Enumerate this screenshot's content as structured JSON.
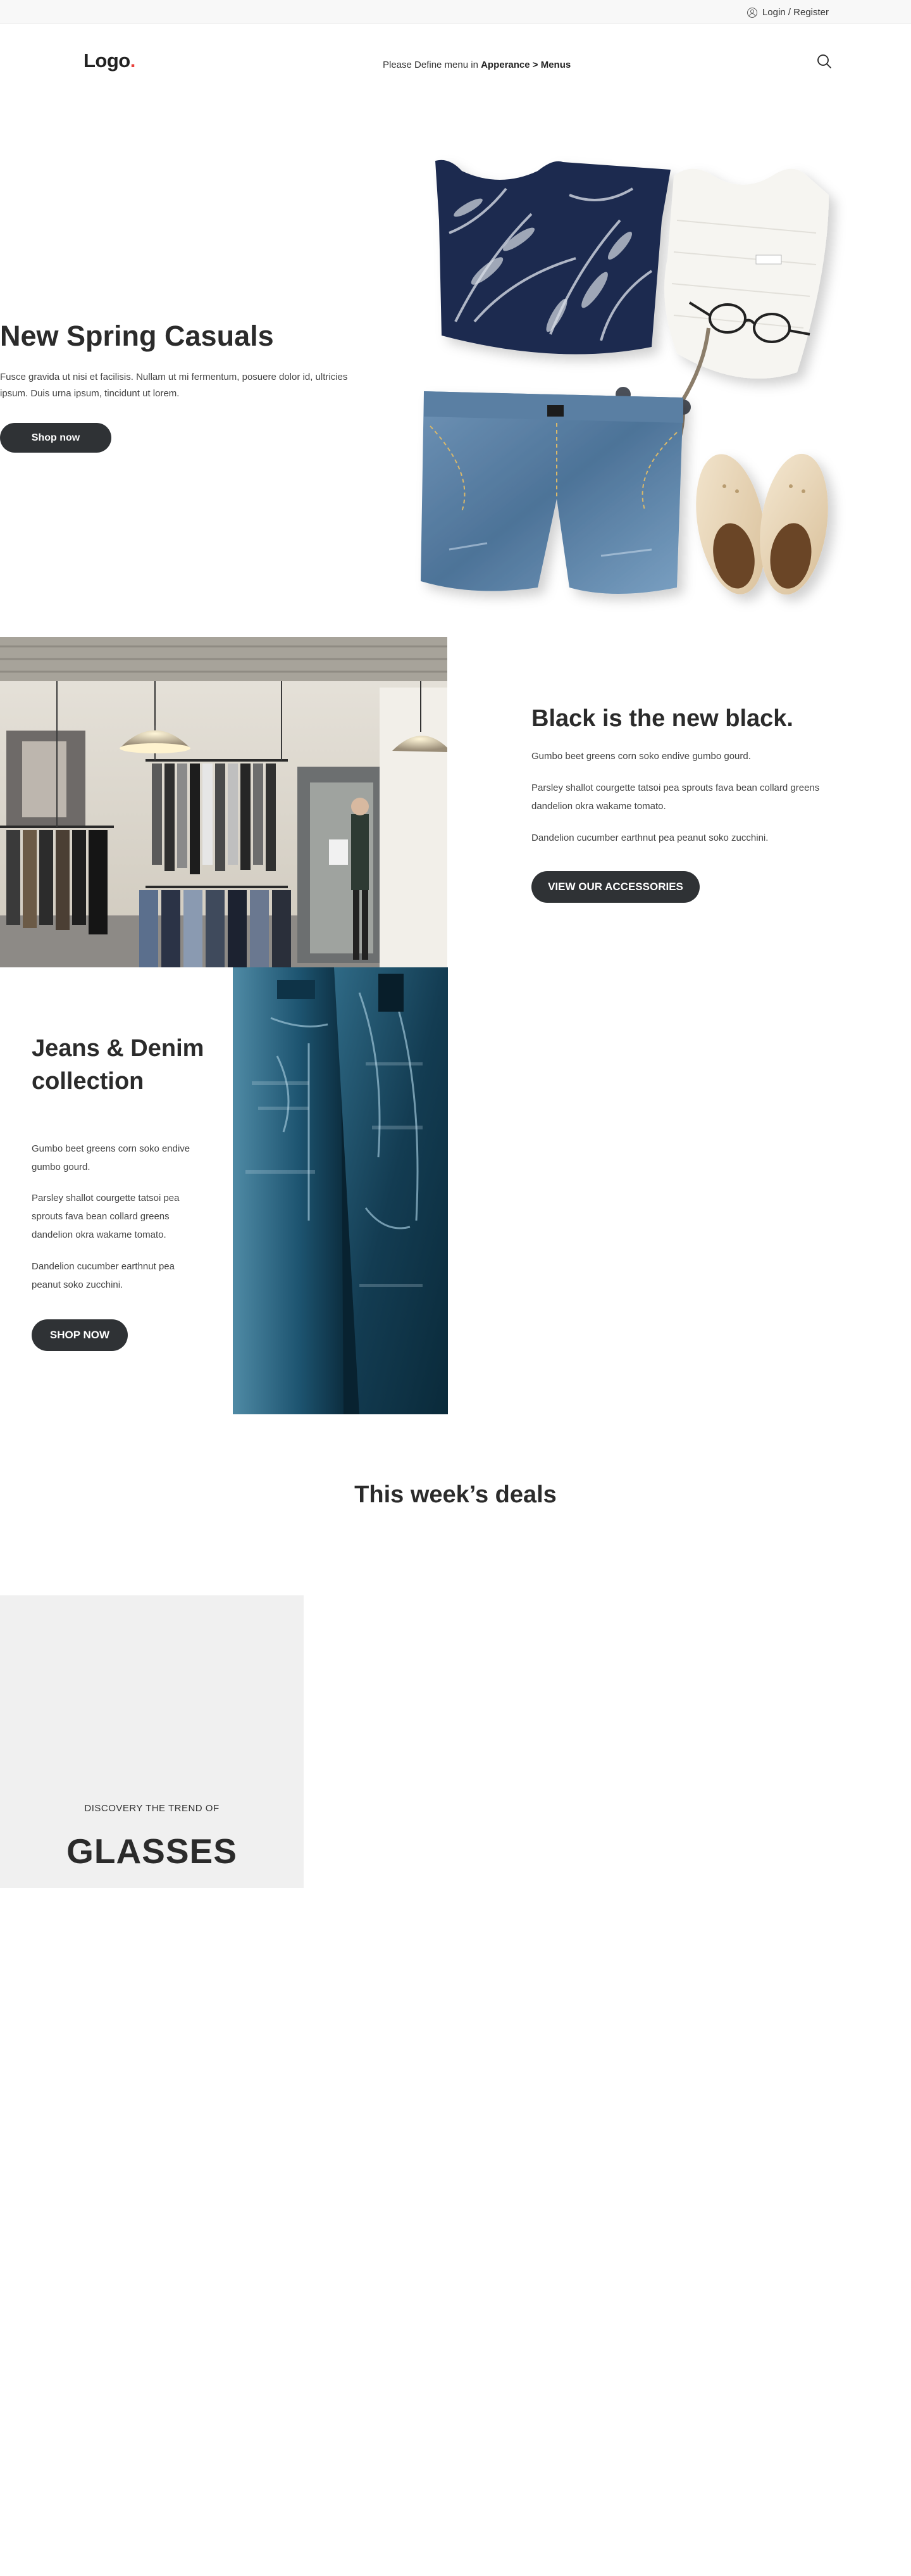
{
  "topbar": {
    "login_label": "Login / Register",
    "icon": "user-icon"
  },
  "header": {
    "logo_text": "Logo",
    "logo_dot": ".",
    "menu_prefix": "Please Define menu in ",
    "menu_path": "Apperance > Menus",
    "search_icon": "search-icon"
  },
  "hero": {
    "title": "New Spring Casuals",
    "text": "Fusce gravida ut nisi et facilisis. Nullam ut mi fermentum, posuere dolor id, ultricies ipsum. Duis urna ipsum, tincidunt ut lorem.",
    "button": "Shop now"
  },
  "black": {
    "title": "Black is the new black.",
    "p1": "Gumbo beet greens corn soko endive gumbo gourd.",
    "p2": "Parsley shallot courgette tatsoi pea sprouts fava bean collard greens dandelion okra wakame tomato.",
    "p3": "Dandelion cucumber earthnut pea peanut soko zucchini.",
    "button": "VIEW OUR ACCESSORIES"
  },
  "jeans": {
    "title": "Jeans & Denim collection",
    "p1": "Gumbo beet greens corn soko endive gumbo gourd.",
    "p2": "Parsley shallot courgette tatsoi pea sprouts fava bean collard greens dandelion okra wakame tomato.",
    "p3": "Dandelion cucumber earthnut pea peanut soko zucchini.",
    "button": "SHOP NOW"
  },
  "deals": {
    "title": "This week’s deals",
    "promo_kicker": "DISCOVERY THE TREND OF",
    "promo_title": "GLASSES"
  },
  "colors": {
    "dark_button": "#2f3235",
    "logo_dot": "#e8413c",
    "promo_bg": "#f0f0f0"
  }
}
